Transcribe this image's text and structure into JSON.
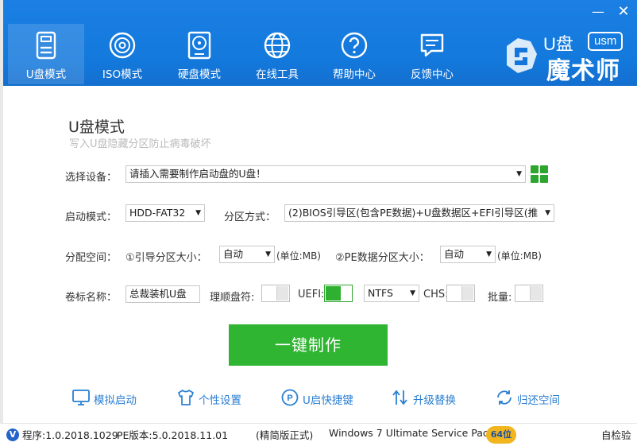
{
  "window": {
    "minimize": "—",
    "close": "✕"
  },
  "nav": [
    {
      "label": "U盘模式",
      "icon": "usb-drive-icon",
      "active": true
    },
    {
      "label": "ISO模式",
      "icon": "disc-icon"
    },
    {
      "label": "硬盘模式",
      "icon": "hard-disk-icon"
    },
    {
      "label": "在线工具",
      "icon": "globe-icon"
    },
    {
      "label": "帮助中心",
      "icon": "question-icon"
    },
    {
      "label": "反馈中心",
      "icon": "chat-bubble-icon"
    }
  ],
  "brand": {
    "u": "U盘",
    "tag": "usm",
    "name": "魔术师"
  },
  "page": {
    "title": "U盘模式",
    "subtitle": "写入U盘隐藏分区防止病毒破坏"
  },
  "device": {
    "label": "选择设备：",
    "value": "请插入需要制作启动盘的U盘！",
    "refresh_icon": "grid-refresh-icon"
  },
  "boot": {
    "label": "启动模式：",
    "value": "HDD-FAT32",
    "partition_label": "分区方式：",
    "partition_value": "(2)BIOS引导区(包含PE数据)+U盘数据区+EFI引导区(推"
  },
  "space": {
    "label": "分配空间：",
    "boot_size_label": "①引导分区大小：",
    "boot_size_value": "自动",
    "unit1": "(单位:MB)",
    "pe_size_label": "②PE数据分区大小：",
    "pe_size_value": "自动",
    "unit2": "(单位:MB)"
  },
  "volume": {
    "label": "卷标名称：",
    "value": "总裁装机U盘",
    "sort_label": "理顺盘符:",
    "uefi_label": "UEFI:",
    "fs_value": "NTFS",
    "chs_label": "CHS:",
    "batch_label": "批量:"
  },
  "make_button": "一键制作",
  "tools": [
    {
      "label": "模拟启动",
      "icon": "monitor-icon"
    },
    {
      "label": "个性设置",
      "icon": "tshirt-icon"
    },
    {
      "label": "U启快捷键",
      "icon": "shortcut-key-icon"
    },
    {
      "label": "升级替换",
      "icon": "upgrade-arrows-icon"
    },
    {
      "label": "归还空间",
      "icon": "restore-icon"
    }
  ],
  "status": {
    "logo": "V",
    "program": "程序:1.0.2018.1029",
    "pe": "PE版本:5.0.2018.11.01",
    "edition": "(精简版正式)",
    "os": "Windows 7 Ultimate Service Pack 1",
    "bits": "64位",
    "check": "自检验"
  }
}
